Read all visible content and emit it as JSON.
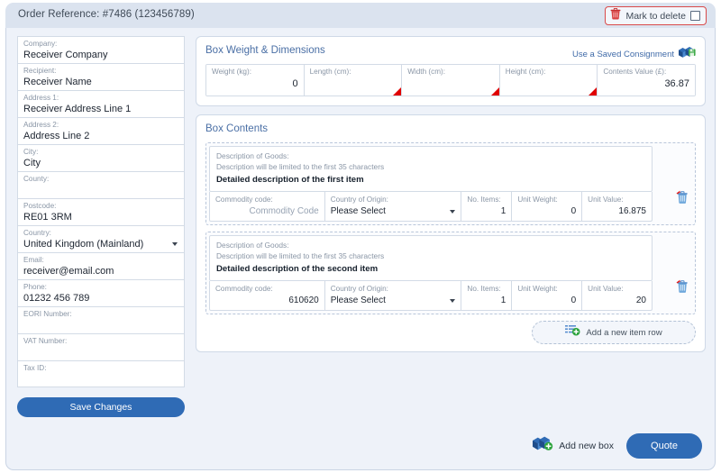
{
  "header": {
    "order_reference": "Order Reference: #7486 (123456789)",
    "mark_to_delete_label": "Mark to delete",
    "trash_icon": "trash-icon",
    "checkbox_checked": false
  },
  "receiver_form": {
    "fields": [
      {
        "label": "Company:",
        "value": "Receiver Company",
        "type": "text"
      },
      {
        "label": "Recipient:",
        "value": "Receiver Name",
        "type": "text"
      },
      {
        "label": "Address 1:",
        "value": "Receiver Address Line 1",
        "type": "text"
      },
      {
        "label": "Address 2:",
        "value": "Address Line 2",
        "type": "text"
      },
      {
        "label": "City:",
        "value": "City",
        "type": "text"
      },
      {
        "label": "County:",
        "value": "",
        "type": "text"
      },
      {
        "label": "Postcode:",
        "value": "RE01 3RM",
        "type": "text"
      },
      {
        "label": "Country:",
        "value": "United Kingdom (Mainland)",
        "type": "select"
      },
      {
        "label": "Email:",
        "value": "receiver@email.com",
        "type": "text"
      },
      {
        "label": "Phone:",
        "value": "01232 456 789",
        "type": "text"
      },
      {
        "label": "EORI Number:",
        "value": "",
        "type": "text"
      },
      {
        "label": "VAT Number:",
        "value": "",
        "type": "text"
      },
      {
        "label": "Tax ID:",
        "value": "",
        "type": "text"
      }
    ],
    "save_button_label": "Save Changes"
  },
  "weight_panel": {
    "title": "Box Weight & Dimensions",
    "saved_consignment_label": "Use a Saved Consignment",
    "saved_consignment_icon": "box-save-icon",
    "cells": [
      {
        "label": "Weight (kg):",
        "value": "0",
        "warning": false
      },
      {
        "label": "Length (cm):",
        "value": "",
        "warning": true
      },
      {
        "label": "Width (cm):",
        "value": "",
        "warning": true
      },
      {
        "label": "Height (cm):",
        "value": "",
        "warning": true
      },
      {
        "label": "Contents Value (£):",
        "value": "36.87",
        "warning": false
      }
    ]
  },
  "box_contents": {
    "title": "Box Contents",
    "description_label": "Description of Goods:",
    "description_hint": "Description will be limited to the first 35 characters",
    "column_labels": {
      "commodity": "Commodity code:",
      "origin": "Country of Origin:",
      "items": "No. Items:",
      "unit_weight": "Unit Weight:",
      "unit_value": "Unit Value:"
    },
    "delete_row_icon": "trash-icon",
    "items": [
      {
        "description": "Detailed description of the first item",
        "commodity_code": "Commodity Code",
        "commodity_is_placeholder": true,
        "country_of_origin": "Please Select",
        "no_items": "1",
        "unit_weight": "0",
        "unit_value": "16.875"
      },
      {
        "description": "Detailed description of the second item",
        "commodity_code": "610620",
        "commodity_is_placeholder": false,
        "country_of_origin": "Please Select",
        "no_items": "1",
        "unit_weight": "0",
        "unit_value": "20"
      }
    ],
    "add_item_label": "Add a new item row",
    "add_item_icon": "list-add-icon"
  },
  "footer": {
    "add_new_box_label": "Add new box",
    "add_new_box_icon": "box-add-icon",
    "quote_button_label": "Quote"
  },
  "colors": {
    "accent_blue": "#2f6bb5",
    "panel_bg": "#eef2f9",
    "header_bg": "#dbe3ef",
    "danger_red": "#d94a4a",
    "warning_red": "#e00000",
    "label_grey": "#8a96a6"
  }
}
